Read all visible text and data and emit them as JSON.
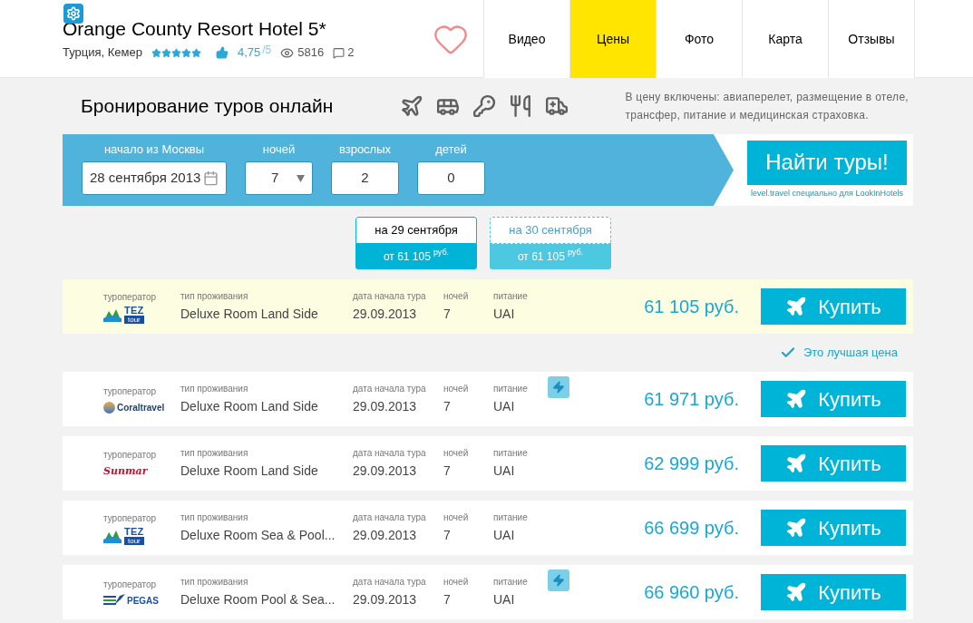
{
  "hotel": {
    "name": "Orange County Resort Hotel 5*",
    "location": "Турция, Кемер",
    "stars": 5,
    "rating": "4,75",
    "rating_max": "/5",
    "views": "5816",
    "comments": "2"
  },
  "nav": [
    {
      "label": "Видео",
      "selected": false
    },
    {
      "label": "Цены",
      "selected": true
    },
    {
      "label": "Фото",
      "selected": false
    },
    {
      "label": "Карта",
      "selected": false
    },
    {
      "label": "Отзывы",
      "selected": false
    }
  ],
  "booking": {
    "title": "Бронирование туров онлайн",
    "included_note": "В цену включены: авиаперелет, размещение в отеле, трансфер, питание и медицинская страховка.",
    "fields": [
      {
        "label": "начало из Москвы",
        "value": "28 сентября 2013",
        "kind": "date"
      },
      {
        "label": "ночей",
        "value": "7",
        "kind": "select"
      },
      {
        "label": "взрослых",
        "value": "2",
        "kind": "text"
      },
      {
        "label": "детей",
        "value": "0",
        "kind": "text"
      }
    ],
    "search_button": "Найти туры!",
    "partner_note": "level.travel специально для LookInHotels"
  },
  "date_tabs": [
    {
      "date": "на 29 сентября",
      "price": "от 61 105",
      "currency": "руб.",
      "selected": true
    },
    {
      "date": "на 30 сентября",
      "price": "от 61 105",
      "currency": "руб.",
      "selected": false
    }
  ],
  "best_note": "Это лучшая цена",
  "offers": [
    {
      "operator_label": "туроператор",
      "logo": {
        "kind": "tez",
        "text": "TEZ",
        "sub": "tour"
      },
      "room_label": "тип проживания",
      "room": "Deluxe Room Land Side",
      "date_label": "дата начала тура",
      "date": "29.09.2013",
      "nights_label": "ночей",
      "nights": "7",
      "meal_label": "питание",
      "meal": "UAI",
      "instant": false,
      "price": "61 105 руб.",
      "buy": "Купить",
      "best": true
    },
    {
      "operator_label": "туроператор",
      "logo": {
        "kind": "coral",
        "text": "Coraltravel"
      },
      "room_label": "тип проживания",
      "room": "Deluxe Room Land Side",
      "date_label": "дата начала тура",
      "date": "29.09.2013",
      "nights_label": "ночей",
      "nights": "7",
      "meal_label": "питание",
      "meal": "UAI",
      "instant": true,
      "price": "61 971 руб.",
      "buy": "Купить",
      "best": false
    },
    {
      "operator_label": "туроператор",
      "logo": {
        "kind": "sunmar",
        "text": "Sunmar"
      },
      "room_label": "тип проживания",
      "room": "Deluxe Room Land Side",
      "date_label": "дата начала тура",
      "date": "29.09.2013",
      "nights_label": "ночей",
      "nights": "7",
      "meal_label": "питание",
      "meal": "UAI",
      "instant": false,
      "price": "62 999 руб.",
      "buy": "Купить",
      "best": false
    },
    {
      "operator_label": "туроператор",
      "logo": {
        "kind": "tez",
        "text": "TEZ",
        "sub": "tour"
      },
      "room_label": "тип проживания",
      "room": "Deluxe Room Sea & Pool...",
      "date_label": "дата начала тура",
      "date": "29.09.2013",
      "nights_label": "ночей",
      "nights": "7",
      "meal_label": "питание",
      "meal": "UAI",
      "instant": false,
      "price": "66 699 руб.",
      "buy": "Купить",
      "best": false
    },
    {
      "operator_label": "туроператор",
      "logo": {
        "kind": "pegas",
        "text": "PEGAS"
      },
      "room_label": "тип проживания",
      "room": "Deluxe Room Pool & Sea...",
      "date_label": "дата начала тура",
      "date": "29.09.2013",
      "nights_label": "ночей",
      "nights": "7",
      "meal_label": "питание",
      "meal": "UAI",
      "instant": true,
      "price": "66 960 руб.",
      "buy": "Купить",
      "best": false
    }
  ]
}
